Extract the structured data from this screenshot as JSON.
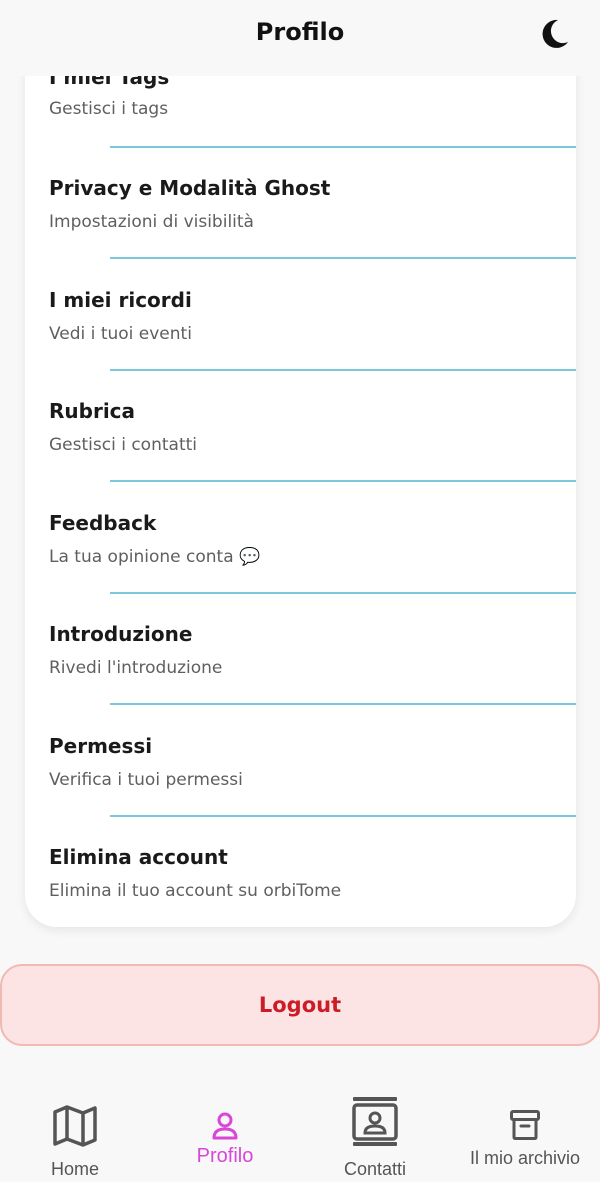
{
  "header": {
    "title": "Profilo",
    "theme_icon": "moon-icon"
  },
  "menu": [
    {
      "title": "I miei Tags",
      "subtitle": "Gestisci i tags"
    },
    {
      "title": "Privacy e Modalità Ghost",
      "subtitle": "Impostazioni di visibilità"
    },
    {
      "title": "I miei ricordi",
      "subtitle": "Vedi i tuoi eventi"
    },
    {
      "title": "Rubrica",
      "subtitle": "Gestisci i contatti"
    },
    {
      "title": "Feedback",
      "subtitle": "La tua opinione conta 💬"
    },
    {
      "title": "Introduzione",
      "subtitle": "Rivedi l'introduzione"
    },
    {
      "title": "Permessi",
      "subtitle": "Verifica i tuoi permessi"
    },
    {
      "title": "Elimina account",
      "subtitle": "Elimina il tuo account su orbiTome"
    }
  ],
  "logout": {
    "label": "Logout"
  },
  "nav": {
    "items": [
      {
        "label": "Home",
        "icon": "map-icon"
      },
      {
        "label": "Profilo",
        "icon": "user-icon",
        "active": true
      },
      {
        "label": "Contatti",
        "icon": "contacts-icon"
      },
      {
        "label": "Il mio archivio",
        "icon": "archive-icon"
      }
    ],
    "active_color": "#d946d8",
    "inactive_color": "#555555"
  },
  "colors": {
    "divider": "#7cc6de",
    "logout_text": "#cc1d26",
    "logout_bg": "#fce4e4"
  }
}
